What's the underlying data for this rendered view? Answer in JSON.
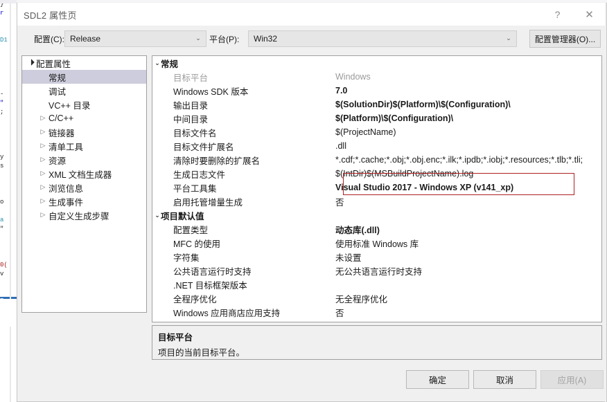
{
  "window": {
    "title": "SDL2 属性页",
    "help_icon": "?",
    "help_icon_name": "help-icon",
    "close_icon": "✕",
    "close_icon_name": "close-icon"
  },
  "toolbar": {
    "config_label": "配置(C):",
    "config_value": "Release",
    "platform_label": "平台(P):",
    "platform_value": "Win32",
    "config_manager_label": "配置管理器(O)...",
    "dropdown_arrow": "⌄"
  },
  "tree": {
    "items": [
      {
        "label": "配置属性",
        "indent": 0,
        "twisty": "open",
        "selected": false
      },
      {
        "label": "常规",
        "indent": 1,
        "twisty": "none",
        "selected": true
      },
      {
        "label": "调试",
        "indent": 1,
        "twisty": "none",
        "selected": false
      },
      {
        "label": "VC++ 目录",
        "indent": 1,
        "twisty": "none",
        "selected": false
      },
      {
        "label": "C/C++",
        "indent": 1,
        "twisty": "closed",
        "selected": false
      },
      {
        "label": "链接器",
        "indent": 1,
        "twisty": "closed",
        "selected": false
      },
      {
        "label": "清单工具",
        "indent": 1,
        "twisty": "closed",
        "selected": false
      },
      {
        "label": "资源",
        "indent": 1,
        "twisty": "closed",
        "selected": false
      },
      {
        "label": "XML 文档生成器",
        "indent": 1,
        "twisty": "closed",
        "selected": false
      },
      {
        "label": "浏览信息",
        "indent": 1,
        "twisty": "closed",
        "selected": false
      },
      {
        "label": "生成事件",
        "indent": 1,
        "twisty": "closed",
        "selected": false
      },
      {
        "label": "自定义生成步骤",
        "indent": 1,
        "twisty": "closed",
        "selected": false
      }
    ]
  },
  "grid": {
    "collapse_arrow": "⌄",
    "rows": [
      {
        "kind": "category",
        "name": "常规",
        "value": ""
      },
      {
        "kind": "prop",
        "dim": true,
        "name": "目标平台",
        "value": "Windows"
      },
      {
        "kind": "prop",
        "bold": true,
        "name": "Windows SDK 版本",
        "value": "7.0"
      },
      {
        "kind": "prop",
        "bold": true,
        "name": "输出目录",
        "value": "$(SolutionDir)$(Platform)\\$(Configuration)\\"
      },
      {
        "kind": "prop",
        "bold": true,
        "name": "中间目录",
        "value": "$(Platform)\\$(Configuration)\\"
      },
      {
        "kind": "prop",
        "name": "目标文件名",
        "value": "$(ProjectName)"
      },
      {
        "kind": "prop",
        "name": "目标文件扩展名",
        "value": ".dll"
      },
      {
        "kind": "prop",
        "name": "清除时要删除的扩展名",
        "value": "*.cdf;*.cache;*.obj;*.obj.enc;*.ilk;*.ipdb;*.iobj;*.resources;*.tlb;*.tli;"
      },
      {
        "kind": "prop",
        "name": "生成日志文件",
        "value": "$(IntDir)$(MSBuildProjectName).log"
      },
      {
        "kind": "prop",
        "bold": true,
        "name": "平台工具集",
        "value": "Visual Studio 2017 - Windows XP (v141_xp)"
      },
      {
        "kind": "prop",
        "name": "启用托管增量生成",
        "value": "否"
      },
      {
        "kind": "category",
        "name": "项目默认值",
        "value": ""
      },
      {
        "kind": "prop",
        "bold": true,
        "name": "配置类型",
        "value": "动态库(.dll)"
      },
      {
        "kind": "prop",
        "name": "MFC 的使用",
        "value": "使用标准 Windows 库"
      },
      {
        "kind": "prop",
        "name": "字符集",
        "value": "未设置"
      },
      {
        "kind": "prop",
        "name": "公共语言运行时支持",
        "value": "无公共语言运行时支持"
      },
      {
        "kind": "prop",
        "name": ".NET 目标框架版本",
        "value": ""
      },
      {
        "kind": "prop",
        "name": "全程序优化",
        "value": "无全程序优化"
      },
      {
        "kind": "prop",
        "name": "Windows 应用商店应用支持",
        "value": "否"
      }
    ]
  },
  "highlight": {
    "color": "#b02020",
    "target_value": "Visual Studio 2017 - Windows XP (v141_xp)"
  },
  "description": {
    "title": "目标平台",
    "body": "项目的当前目标平台。"
  },
  "buttons": {
    "ok": "确定",
    "cancel": "取消",
    "apply": "应用(A)"
  },
  "backdrop": {
    "code_lines": [
      "}",
      "r",
      "",
      "",
      "D1",
      "",
      "",
      "",
      "",
      "",
      "-",
      "\"",
      ";",
      "",
      "",
      "",
      "",
      "y",
      "s",
      "",
      "",
      "",
      "o",
      "",
      "a",
      "\"",
      "",
      "",
      "",
      "0(",
      "v",
      "",
      "",
      "E",
      "",
      "",
      "",
      "",
      "",
      ""
    ]
  }
}
